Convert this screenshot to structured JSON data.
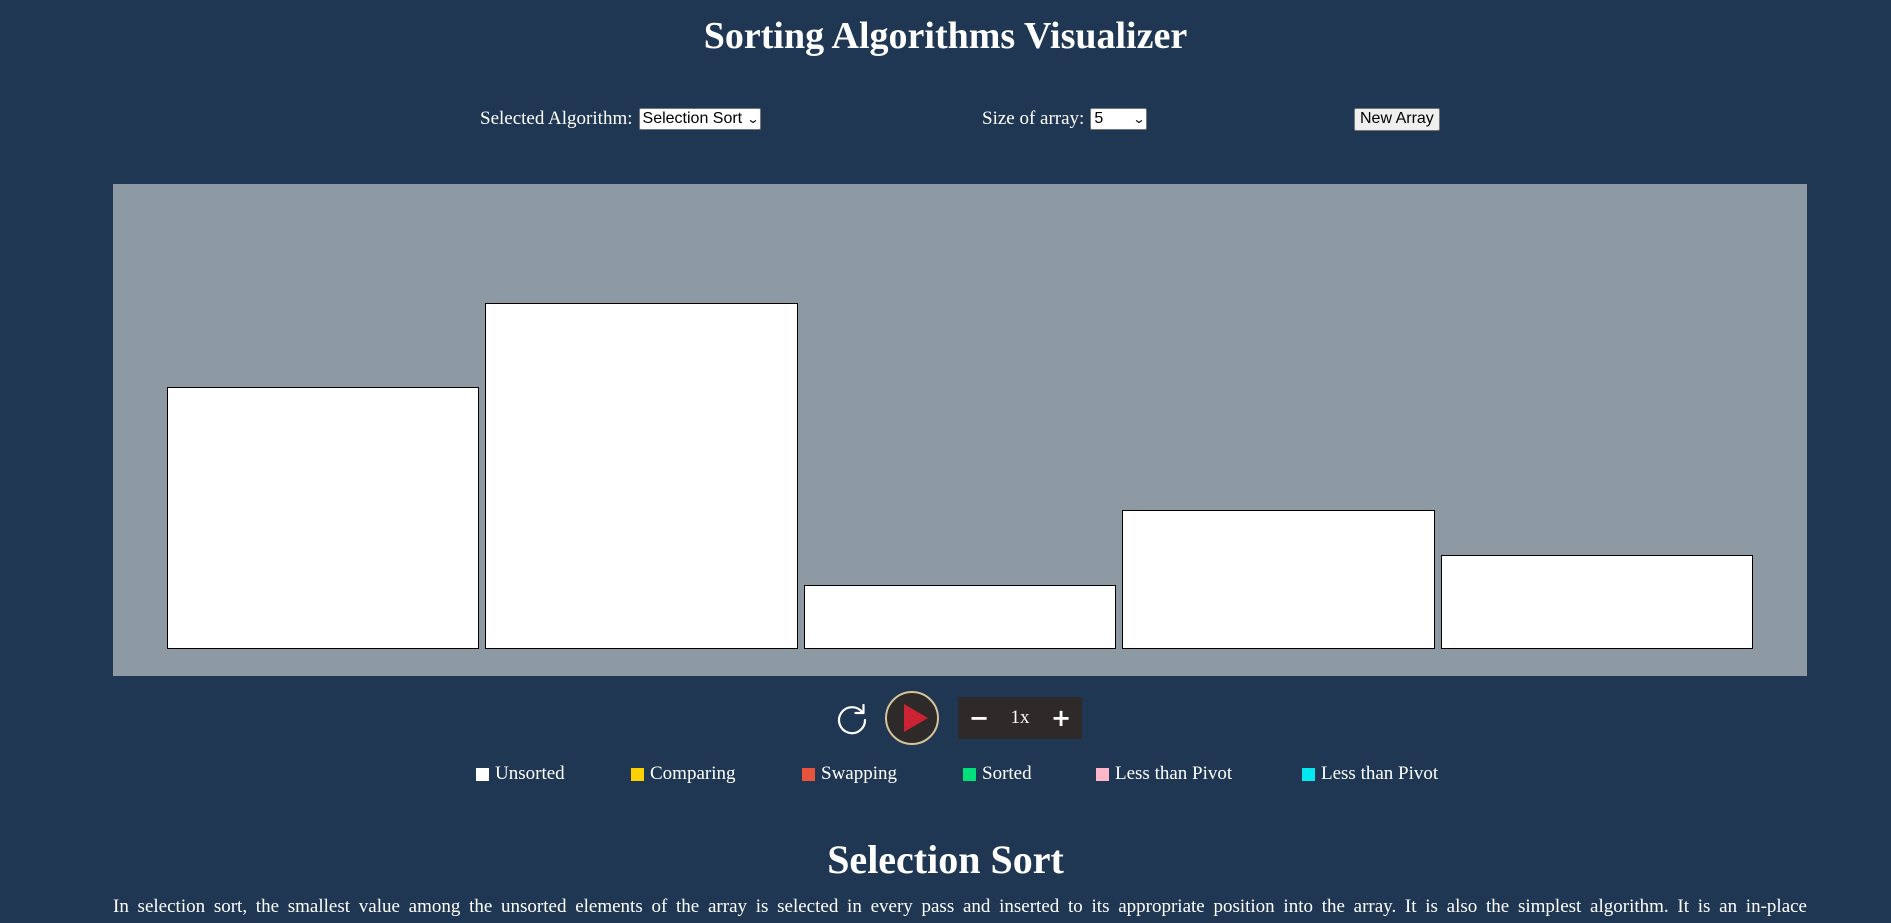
{
  "title": "Sorting Algorithms Visualizer",
  "controls": {
    "algorithm_label": "Selected Algorithm:",
    "algorithm_value": "Selection Sort",
    "size_label": "Size of array:",
    "size_value": "5",
    "new_array_label": "New Array"
  },
  "array": {
    "values": [
      53,
      70,
      13,
      28,
      19
    ],
    "state": "unsorted"
  },
  "player": {
    "reset_icon": "reset-icon",
    "play_icon": "play-icon",
    "speed_minus": "−",
    "speed_value": "1x",
    "speed_plus": "+",
    "play_color": "#cc2233"
  },
  "legend": [
    {
      "label": "Unsorted",
      "color": "#ffffff"
    },
    {
      "label": "Comparing",
      "color": "#ffd000"
    },
    {
      "label": "Swapping",
      "color": "#e8533e"
    },
    {
      "label": "Sorted",
      "color": "#00e07a"
    },
    {
      "label": "Less than Pivot",
      "color": "#ffb6c8"
    },
    {
      "label": "Less than Pivot",
      "color": "#00e8f0"
    }
  ],
  "section": {
    "title": "Selection Sort",
    "description": "In selection sort, the smallest value among the unsorted elements of the array is selected in every pass and inserted to its appropriate position into the array. It is also the simplest algorithm. It is an in-place"
  }
}
